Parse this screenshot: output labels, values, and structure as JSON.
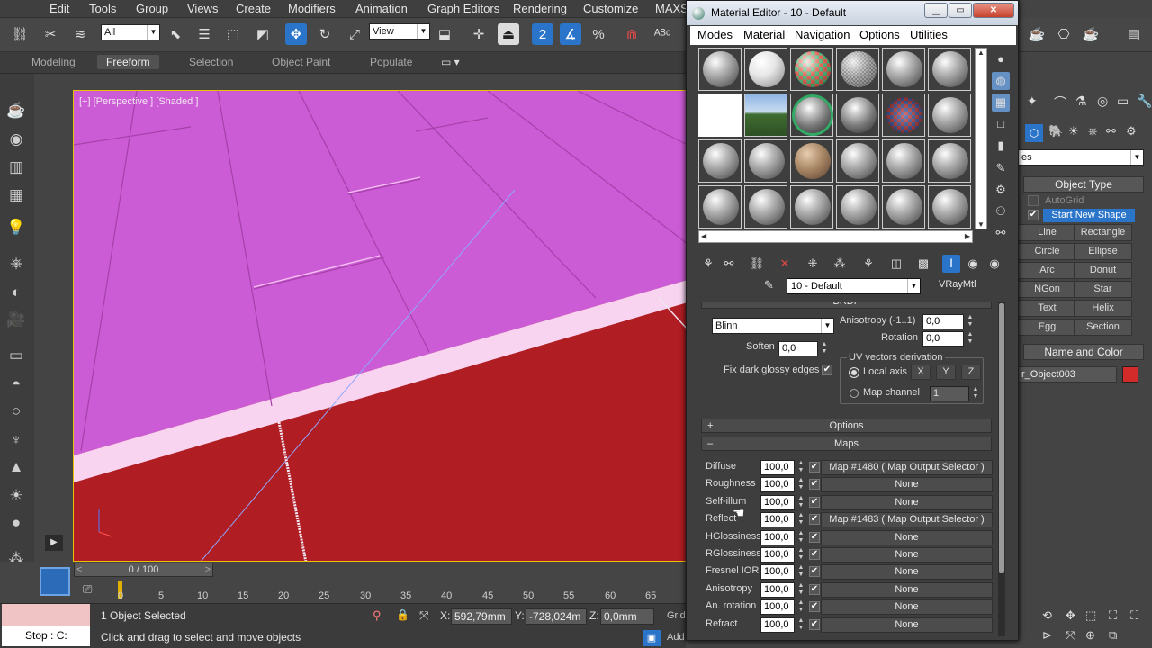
{
  "app": {
    "menu": [
      "Edit",
      "Tools",
      "Group",
      "Views",
      "Create",
      "Modifiers",
      "Animation",
      "Graph Editors",
      "Rendering",
      "Customize",
      "MAXS"
    ],
    "selection_filter": "All",
    "ref_coord": "View",
    "ribbon_tabs": [
      "Modeling",
      "Freeform",
      "Selection",
      "Object Paint",
      "Populate"
    ],
    "active_ribbon_tab": "Freeform"
  },
  "viewport": {
    "label": "[+] [Perspective ] [Shaded ]",
    "colors": {
      "floor": "#b01d23",
      "wall": "#cc5bd6",
      "trim": "#f8d4f0",
      "border": "#e7c200"
    }
  },
  "timeline": {
    "frame": "0 / 100",
    "ticks": [
      "0",
      "5",
      "10",
      "15",
      "20",
      "25",
      "30",
      "35",
      "40",
      "45",
      "50",
      "55",
      "60",
      "65"
    ]
  },
  "status": {
    "selected": "1 Object Selected",
    "prompt": "Click and drag to select and move objects",
    "maxscript_stop": "Stop  :  C:",
    "x_label": "X:",
    "x": "592,79mm",
    "y_label": "Y:",
    "y": "-728,024m",
    "z_label": "Z:",
    "z": "0,0mm",
    "grid": "Grid",
    "add": "Add"
  },
  "command_panel": {
    "category": "es",
    "object_type_header": "Object Type",
    "autogrid": "AutoGrid",
    "start_new_shape": "Start New Shape",
    "shapes": [
      "Line",
      "Rectangle",
      "Circle",
      "Ellipse",
      "Arc",
      "Donut",
      "NGon",
      "Star",
      "Text",
      "Helix",
      "Egg",
      "Section"
    ],
    "name_color_header": "Name and Color",
    "object_name": "r_Object003",
    "object_color": "#d32a2a"
  },
  "material_editor": {
    "title": "Material Editor - 10 - Default",
    "menu": [
      "Modes",
      "Material",
      "Navigation",
      "Options",
      "Utilities"
    ],
    "material_name": "10 - Default",
    "material_type": "VRayMtl",
    "brdf_header": "BRDF",
    "brdf_type": "Blinn",
    "soften_label": "Soften",
    "soften": "0,0",
    "fix_dark_label": "Fix dark glossy edges",
    "anisotropy_label": "Anisotropy (-1..1)",
    "anisotropy": "0,0",
    "rotation_label": "Rotation",
    "rotation": "0,0",
    "uv_group": "UV vectors derivation",
    "local_axis": "Local axis",
    "axes": [
      "X",
      "Y",
      "Z"
    ],
    "map_channel_label": "Map channel",
    "map_channel": "1",
    "options_header": "Options",
    "maps_header": "Maps",
    "maps": [
      {
        "name": "Diffuse",
        "amount": "100,0",
        "map": "Map #1480  ( Map Output Selector )"
      },
      {
        "name": "Roughness",
        "amount": "100,0",
        "map": "None"
      },
      {
        "name": "Self-illum",
        "amount": "100,0",
        "map": "None"
      },
      {
        "name": "Reflect",
        "amount": "100,0",
        "map": "Map #1483  ( Map Output Selector )"
      },
      {
        "name": "HGlossiness",
        "amount": "100,0",
        "map": "None"
      },
      {
        "name": "RGlossiness",
        "amount": "100,0",
        "map": "None"
      },
      {
        "name": "Fresnel IOR",
        "amount": "100,0",
        "map": "None"
      },
      {
        "name": "Anisotropy",
        "amount": "100,0",
        "map": "None"
      },
      {
        "name": "An. rotation",
        "amount": "100,0",
        "map": "None"
      },
      {
        "name": "Refract",
        "amount": "100,0",
        "map": "None"
      }
    ]
  }
}
